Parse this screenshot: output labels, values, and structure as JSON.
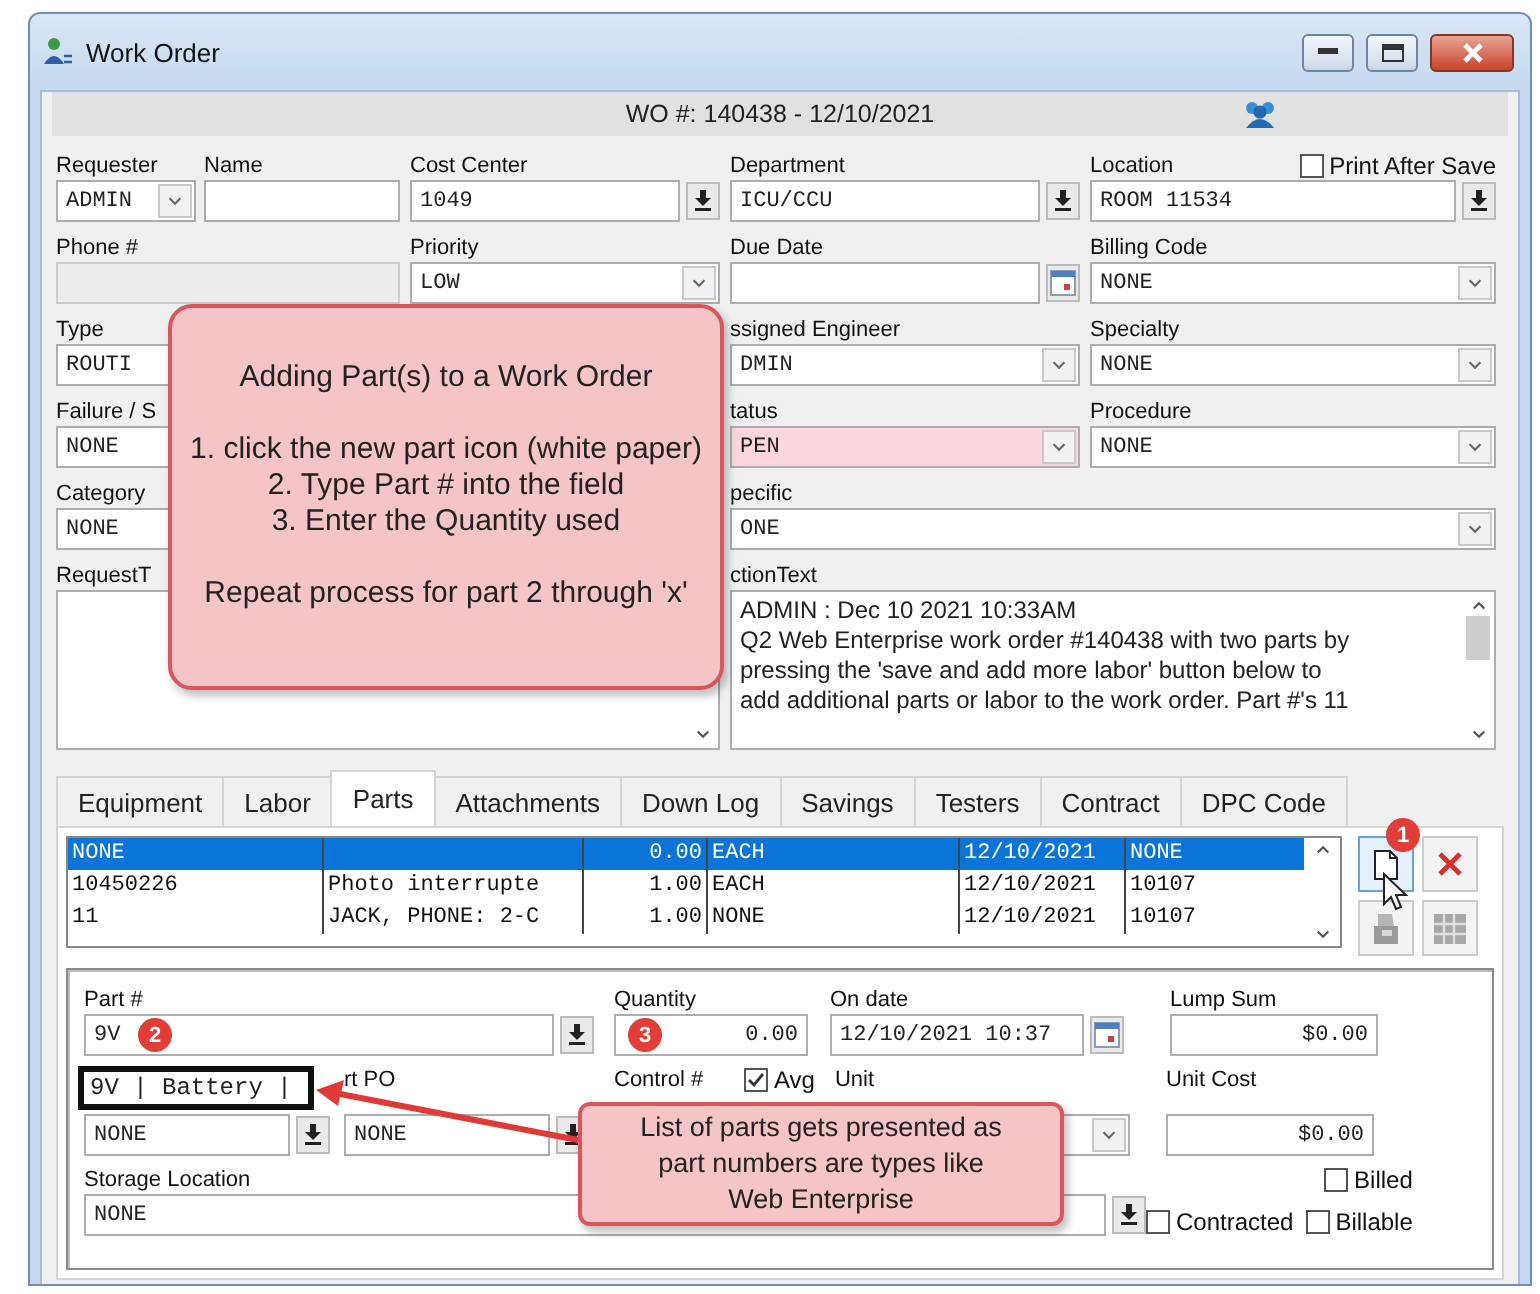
{
  "window": {
    "title": "Work Order"
  },
  "header": {
    "text": "WO #: 140438 - 12/10/2021"
  },
  "form": {
    "print_after_save": {
      "label": "Print After Save",
      "checked": false
    },
    "rows": [
      {
        "col_1": [
          {
            "label": "Requester",
            "value": "ADMIN",
            "kind": "combo"
          },
          {
            "label": "Name",
            "kind": "text"
          }
        ],
        "col_2": [
          {
            "label": "Cost Center",
            "value": "1049",
            "kind": "lookup"
          }
        ],
        "col_3": [
          {
            "label": "Department",
            "value": "ICU/CCU",
            "kind": "lookup"
          }
        ],
        "col_4": [
          {
            "label": "Location",
            "value": "ROOM 11534",
            "kind": "lookup"
          }
        ]
      },
      {
        "col_1": [
          {
            "label": "Phone #",
            "kind": "readonly"
          }
        ],
        "col_2": [
          {
            "label": "Priority",
            "value": "LOW",
            "kind": "combo"
          }
        ],
        "col_3": [
          {
            "label": "Due Date",
            "kind": "date"
          }
        ],
        "col_4": [
          {
            "label": "Billing Code",
            "value": "NONE",
            "kind": "combo"
          }
        ]
      },
      {
        "col_1": [
          {
            "label": "Type",
            "value": "ROUTI",
            "kind": "text"
          }
        ],
        "col_3": [
          {
            "label": "ssigned Engineer",
            "value": "DMIN",
            "kind": "combo"
          }
        ],
        "col_4": [
          {
            "label": "Specialty",
            "value": "NONE",
            "kind": "combo"
          }
        ]
      },
      {
        "col_1": [
          {
            "label": "Failure / S",
            "value": "NONE",
            "kind": "text"
          }
        ],
        "col_3": [
          {
            "label": "tatus",
            "value": "PEN",
            "kind": "combo-alert"
          }
        ],
        "col_4": [
          {
            "label": "Procedure",
            "value": "NONE",
            "kind": "combo"
          }
        ]
      },
      {
        "col_1": [
          {
            "label": "Category",
            "value": "NONE",
            "kind": "text"
          }
        ],
        "col_3": [
          {
            "label": "pecific",
            "value": "ONE",
            "kind": "combo"
          }
        ]
      },
      {
        "col_1": [
          {
            "label": "RequestT",
            "kind": "textarea"
          }
        ],
        "col_3": [
          {
            "label": "ctionText",
            "kind": "textarea",
            "lines": [
              "ADMIN : Dec 10 2021 10:33AM",
              "Q2 Web Enterprise work order #140438 with two parts by",
              "pressing the 'save and add more labor' button below to",
              "add additional parts or labor to the work order. Part #'s 11"
            ]
          }
        ]
      }
    ]
  },
  "instructions_callout": {
    "paragraphs": [
      "Adding Part(s) to a Work Order",
      "1. click the new part icon (white paper)\n2. Type Part # into the field\n3. Enter the Quantity used",
      "Repeat process for part 2 through 'x'"
    ]
  },
  "tabs": [
    {
      "label": "Equipment",
      "selected": false
    },
    {
      "label": "Labor",
      "selected": false
    },
    {
      "label": "Parts",
      "selected": true
    },
    {
      "label": "Attachments",
      "selected": false
    },
    {
      "label": "Down Log",
      "selected": false
    },
    {
      "label": "Savings",
      "selected": false
    },
    {
      "label": "Testers",
      "selected": false
    },
    {
      "label": "Contract",
      "selected": false
    },
    {
      "label": "DPC Code",
      "selected": false
    }
  ],
  "parts_table": {
    "rows": [
      {
        "column_1": "NONE",
        "column_3": "0.00",
        "column_4": "EACH",
        "column_5": "12/10/2021",
        "column_6": "NONE",
        "selected": true
      },
      {
        "column_1": "10450226",
        "column_2": "Photo interrupte",
        "column_3": "1.00",
        "column_4": "EACH",
        "column_5": "12/10/2021",
        "column_6": "10107",
        "selected": false
      },
      {
        "column_1": "11",
        "column_2": "JACK, PHONE: 2-C",
        "column_3": "1.00",
        "column_4": "NONE",
        "column_5": "12/10/2021",
        "column_6": "10107",
        "selected": false
      }
    ],
    "new_part_badge": "1"
  },
  "part_detail": {
    "part_number": {
      "label": "Part #",
      "value": "9V",
      "badge": "2"
    },
    "quantity": {
      "label": "Quantity",
      "value": "0.00",
      "badge": "3"
    },
    "on_date": {
      "label": "On date",
      "value": "12/10/2021 10:37"
    },
    "lump_sum": {
      "label": "Lump Sum",
      "value": "$0.00"
    },
    "vendor": {
      "value": "NONE"
    },
    "part_po": {
      "label": "rt PO",
      "value": "NONE"
    },
    "control": {
      "label": "Control #"
    },
    "avg": {
      "label": "Avg",
      "checked": true
    },
    "unit": {
      "label": "Unit"
    },
    "unit_cost": {
      "label": "Unit Cost",
      "value": "$0.00"
    },
    "storage_location": {
      "label": "Storage Location",
      "value": "NONE"
    },
    "billed": {
      "label": "Billed",
      "checked": false
    },
    "contracted": {
      "label": "Contracted",
      "checked": false
    },
    "billable": {
      "label": "Billable",
      "checked": false
    },
    "suggestion": {
      "text": "9V | Battery |"
    },
    "callout": {
      "text": "List of parts gets presented as\npart numbers are types like\nWeb Enterprise"
    }
  }
}
